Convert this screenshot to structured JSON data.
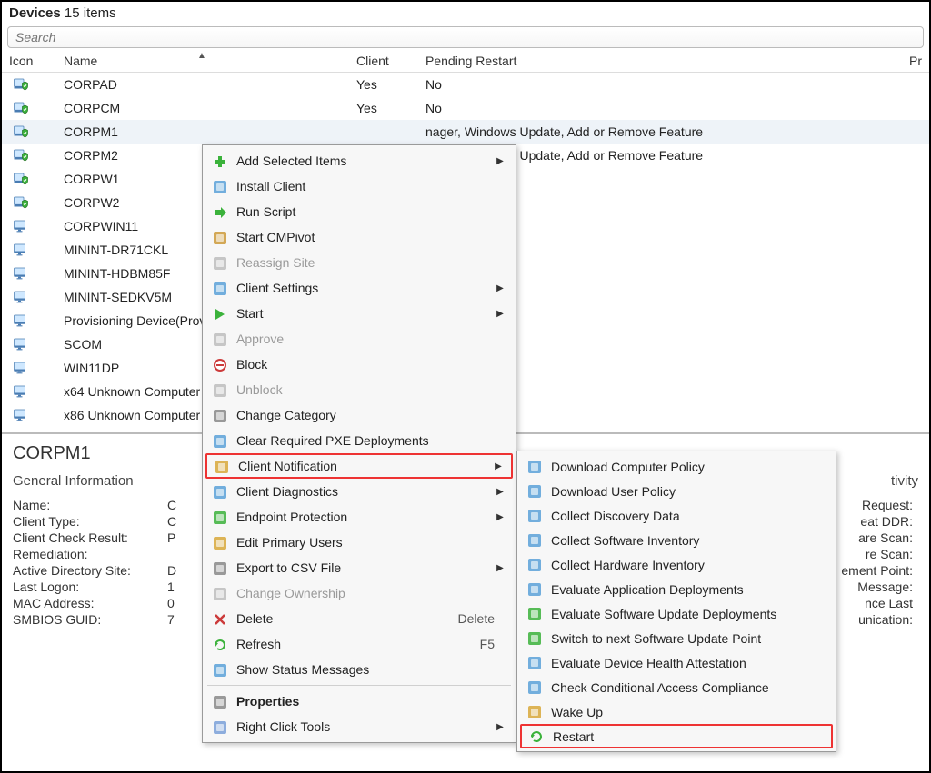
{
  "header": {
    "title": "Devices",
    "count_text": "15 items"
  },
  "search": {
    "placeholder": "Search"
  },
  "columns": {
    "icon": "Icon",
    "name": "Name",
    "client": "Client",
    "pending": "Pending Restart",
    "pri": "Pr"
  },
  "devices": [
    {
      "name": "CORPAD",
      "client": "Yes",
      "pending": "No",
      "iconType": "shield"
    },
    {
      "name": "CORPCM",
      "client": "Yes",
      "pending": "No",
      "iconType": "shield"
    },
    {
      "name": "CORPM1",
      "client": "",
      "pending": "nager, Windows Update, Add or Remove Feature",
      "iconType": "shield",
      "selected": true
    },
    {
      "name": "CORPM2",
      "client": "",
      "pending": "nager, Windows Update, Add or Remove Feature",
      "iconType": "shield"
    },
    {
      "name": "CORPW1",
      "client": "",
      "pending": "",
      "iconType": "shield"
    },
    {
      "name": "CORPW2",
      "client": "",
      "pending": "",
      "iconType": "shield"
    },
    {
      "name": "CORPWIN11",
      "client": "",
      "pending": "",
      "iconType": "monitor"
    },
    {
      "name": "MININT-DR71CKL",
      "client": "",
      "pending": "",
      "iconType": "monitor"
    },
    {
      "name": "MININT-HDBM85F",
      "client": "",
      "pending": "",
      "iconType": "monitor"
    },
    {
      "name": "MININT-SEDKV5M",
      "client": "",
      "pending": "",
      "iconType": "monitor"
    },
    {
      "name": "Provisioning Device(Prov",
      "client": "",
      "pending": "",
      "iconType": "monitor"
    },
    {
      "name": "SCOM",
      "client": "",
      "pending": "",
      "iconType": "monitor"
    },
    {
      "name": "WIN11DP",
      "client": "",
      "pending": "",
      "iconType": "monitor"
    },
    {
      "name": "x64 Unknown Computer",
      "client": "",
      "pending": "",
      "iconType": "monitor"
    },
    {
      "name": "x86 Unknown Computer",
      "client": "",
      "pending": "",
      "iconType": "monitor"
    }
  ],
  "details": {
    "selected_name": "CORPM1",
    "section_left_title": "General Information",
    "left": [
      {
        "k": "Name:",
        "v": "C"
      },
      {
        "k": "Client Type:",
        "v": "C"
      },
      {
        "k": "Client Check Result:",
        "v": "P"
      },
      {
        "k": "Remediation:",
        "v": ""
      },
      {
        "k": "Active Directory Site:",
        "v": "D"
      },
      {
        "k": "Last Logon:",
        "v": "1"
      },
      {
        "k": "MAC Address:",
        "v": "0"
      },
      {
        "k": "SMBIOS GUID:",
        "v": "7"
      }
    ],
    "section_right_title": "tivity",
    "right": [
      {
        "k": "Request:"
      },
      {
        "k": "eat DDR:"
      },
      {
        "k": "are Scan:"
      },
      {
        "k": "re Scan:"
      },
      {
        "k": "ement Point:"
      },
      {
        "k": "Message:"
      },
      {
        "k": "nce Last"
      },
      {
        "k": "unication:"
      }
    ]
  },
  "context_menu": {
    "items": [
      {
        "label": "Add Selected Items",
        "submenu": true,
        "icon": "plus",
        "color": "#3bb23b"
      },
      {
        "label": "Install Client",
        "icon": "pkg",
        "color": "#5aa1d8"
      },
      {
        "label": "Run Script",
        "icon": "arrow-right",
        "color": "#3bb23b"
      },
      {
        "label": "Start CMPivot",
        "icon": "pivot",
        "color": "#cc9a3a"
      },
      {
        "label": "Reassign Site",
        "icon": "site",
        "disabled": true,
        "color": "#c9a0a0"
      },
      {
        "label": "Client Settings",
        "submenu": true,
        "icon": "settings",
        "color": "#5aa1d8"
      },
      {
        "label": "Start",
        "submenu": true,
        "icon": "play",
        "color": "#3bb23b"
      },
      {
        "label": "Approve",
        "icon": "approve",
        "disabled": true,
        "color": "#bdbdbd"
      },
      {
        "label": "Block",
        "icon": "block",
        "color": "#cc3a3a"
      },
      {
        "label": "Unblock",
        "icon": "unblock",
        "disabled": true,
        "color": "#bdbdbd"
      },
      {
        "label": "Change Category",
        "icon": "category",
        "color": "#888"
      },
      {
        "label": "Clear Required PXE Deployments",
        "icon": "pxe",
        "color": "#5aa1d8"
      },
      {
        "label": "Client Notification",
        "submenu": true,
        "icon": "notify",
        "highlight": true,
        "color": "#d8a83a"
      },
      {
        "label": "Client Diagnostics",
        "submenu": true,
        "icon": "diag",
        "color": "#5aa1d8"
      },
      {
        "label": "Endpoint Protection",
        "submenu": true,
        "icon": "shield",
        "color": "#3bb23b"
      },
      {
        "label": "Edit Primary Users",
        "icon": "users",
        "color": "#d8a83a"
      },
      {
        "label": "Export to CSV File",
        "submenu": true,
        "icon": "export",
        "color": "#888"
      },
      {
        "label": "Change Ownership",
        "icon": "owner",
        "disabled": true,
        "color": "#bdbdbd"
      },
      {
        "label": "Delete",
        "icon": "delete",
        "shortcut": "Delete",
        "color": "#cc3a3a"
      },
      {
        "label": "Refresh",
        "icon": "refresh",
        "shortcut": "F5",
        "color": "#3bb23b"
      },
      {
        "label": "Show Status Messages",
        "icon": "status",
        "color": "#5aa1d8"
      },
      {
        "sep": true
      },
      {
        "label": "Properties",
        "icon": "props",
        "bold": true,
        "color": "#888"
      },
      {
        "label": "Right Click Tools",
        "submenu": true,
        "icon": "rct",
        "color": "#7aa0d8"
      }
    ]
  },
  "submenu": {
    "items": [
      {
        "label": "Download Computer Policy",
        "icon": "policy",
        "color": "#5aa1d8"
      },
      {
        "label": "Download User Policy",
        "icon": "user",
        "color": "#5aa1d8"
      },
      {
        "label": "Collect Discovery Data",
        "icon": "discovery",
        "color": "#5aa1d8"
      },
      {
        "label": "Collect Software Inventory",
        "icon": "swinv",
        "color": "#5aa1d8"
      },
      {
        "label": "Collect Hardware Inventory",
        "icon": "hwinv",
        "color": "#5aa1d8"
      },
      {
        "label": "Evaluate Application Deployments",
        "icon": "appeval",
        "color": "#5aa1d8"
      },
      {
        "label": "Evaluate Software Update Deployments",
        "icon": "sweval",
        "color": "#3bb23b"
      },
      {
        "label": "Switch to next Software Update Point",
        "icon": "switch",
        "color": "#3bb23b"
      },
      {
        "label": "Evaluate Device Health Attestation",
        "icon": "health",
        "color": "#5aa1d8"
      },
      {
        "label": "Check Conditional Access Compliance",
        "icon": "compliance",
        "color": "#5aa1d8"
      },
      {
        "label": "Wake Up",
        "icon": "wake",
        "color": "#d8a83a"
      },
      {
        "label": "Restart",
        "icon": "restart",
        "highlight": true,
        "color": "#3bb23b"
      }
    ]
  }
}
